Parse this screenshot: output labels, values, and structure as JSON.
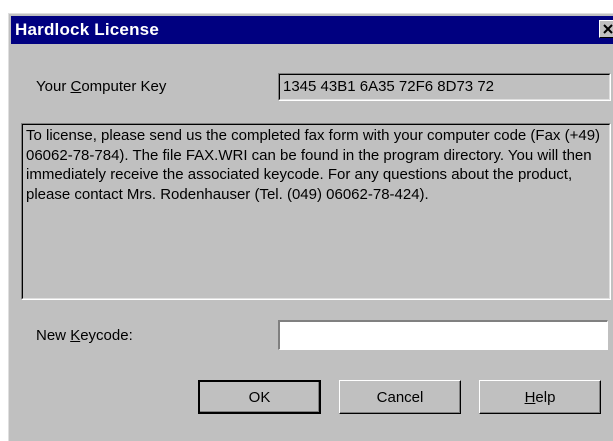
{
  "window": {
    "title": "Hardlock License"
  },
  "computer_key": {
    "label_before": "Your ",
    "label_mnemonic": "C",
    "label_after": "omputer Key",
    "value": "1345 43B1 6A35 72F6 8D73 72"
  },
  "info": {
    "text": "To license, please send us the completed fax form with your computer code (Fax (+49) 06062-78-784). The file FAX.WRI can be found in the program directory. You will then immediately receive the associated keycode. For any questions about the product, please contact Mrs. Rodenhauser (Tel. (049) 06062-78-424)."
  },
  "new_keycode": {
    "label_before": "New ",
    "label_mnemonic": "K",
    "label_after": "eycode:",
    "value": ""
  },
  "buttons": {
    "ok": "OK",
    "cancel": "Cancel",
    "help_mnemonic": "H",
    "help_rest": "elp"
  },
  "colors": {
    "titlebar": "#000080",
    "dialog_face": "#c0c0c0"
  },
  "icons": {
    "close": "close-icon"
  }
}
